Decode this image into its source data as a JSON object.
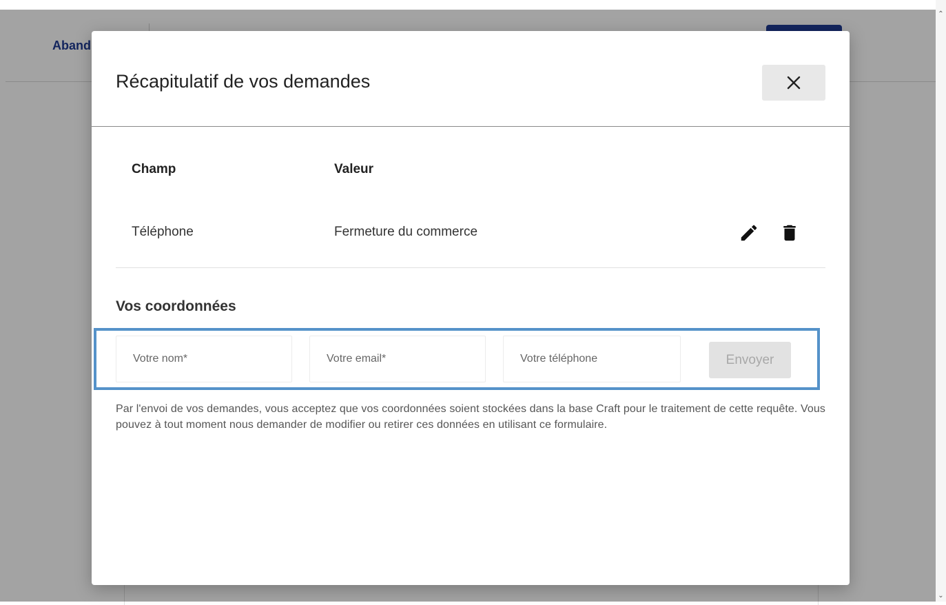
{
  "background": {
    "abandon_link": "Aband",
    "accent_color": "#1f3a93"
  },
  "modal": {
    "title": "Récapitulatif de vos demandes",
    "close_icon": "close-icon",
    "table": {
      "headers": {
        "champ": "Champ",
        "valeur": "Valeur"
      },
      "rows": [
        {
          "champ": "Téléphone",
          "valeur": "Fermeture du commerce",
          "actions": [
            "pencil-icon",
            "trash-icon"
          ]
        }
      ]
    },
    "contact_section": {
      "title": "Vos coordonnées",
      "fields": {
        "name_placeholder": "Votre nom*",
        "email_placeholder": "Votre email*",
        "phone_placeholder": "Votre téléphone"
      },
      "submit_label": "Envoyer",
      "submit_enabled": false,
      "highlight_color": "#5592c9"
    },
    "legal_text": "Par l'envoi de vos demandes, vous acceptez que vos coordonnées soient stockées dans la base Craft pour le traitement de cette requête. Vous pouvez à tout moment nous demander de modifier ou retirer ces données en utilisant ce formulaire."
  }
}
